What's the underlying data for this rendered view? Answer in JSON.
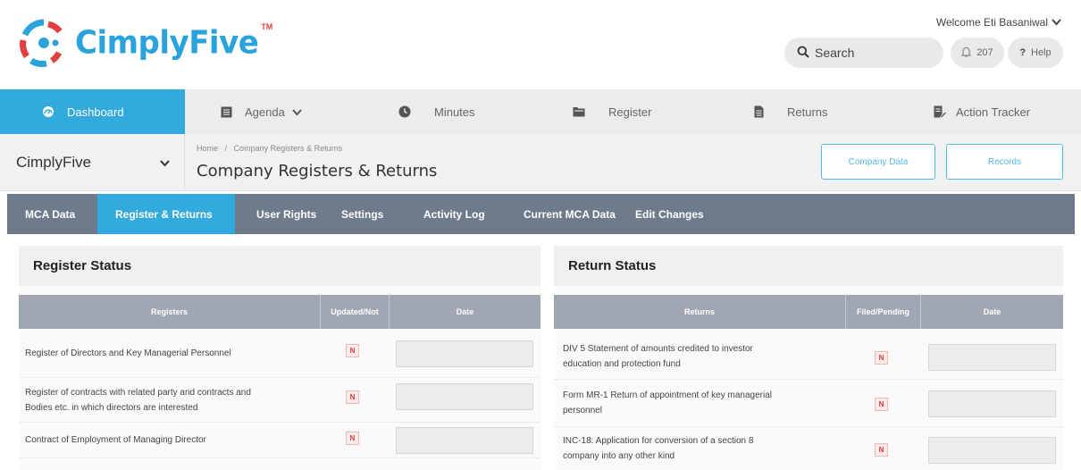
{
  "header": {
    "logo_text": "CimplyFive",
    "logo_tm": "TM",
    "welcome": "Welcome Eti Basaniwal",
    "search_placeholder": "Search",
    "notifications_count": "207",
    "help_label": "Help",
    "help_symbol": "?"
  },
  "colors": {
    "accent": "#33aade",
    "logo_blue": "#2aa3dc",
    "logo_red": "#e04040",
    "tab_bar": "#6d7b8c",
    "table_head": "#a0a7b2",
    "badge_red": "#e03a3a"
  },
  "nav": {
    "items": [
      {
        "label": "Dashboard",
        "icon": "dashboard-gauge-icon",
        "active": true
      },
      {
        "label": "Agenda",
        "icon": "list-icon"
      },
      {
        "label": "Minutes",
        "icon": "clock-icon"
      },
      {
        "label": "Register",
        "icon": "folder-icon"
      },
      {
        "label": "Returns",
        "icon": "document-icon"
      },
      {
        "label": "Action Tracker",
        "icon": "task-edit-icon"
      }
    ]
  },
  "subheader": {
    "company": "CimplyFive",
    "breadcrumb_home": "Home",
    "breadcrumb_sep": "/",
    "breadcrumb_current": "Company Registers & Returns",
    "title": "Company Registers & Returns",
    "company_data_btn": "Company Data",
    "records_btn": "Records"
  },
  "tabs": [
    "MCA Data",
    "Register & Returns",
    "User Rights",
    "Settings",
    "Activity Log",
    "Current MCA Data",
    "Edit Changes"
  ],
  "register_status": {
    "title": "Register Status",
    "columns": [
      "Registers",
      "Updated/Not",
      "Date"
    ],
    "rows": [
      {
        "line1": "Register of Directors and Key Managerial Personnel",
        "line2": "",
        "status": "N"
      },
      {
        "line1": "Register of contracts with related party and contracts and",
        "line2": "Bodies etc. in which directors are interested",
        "status": "N"
      },
      {
        "line1": "Contract of Employment of Managing Director",
        "line2": "",
        "status": "N"
      }
    ]
  },
  "return_status": {
    "title": "Return Status",
    "columns": [
      "Returns",
      "Filed/Pending",
      "Date"
    ],
    "rows": [
      {
        "line1": "DIV 5 Statement of amounts credited to investor",
        "line2": "education and protection fund",
        "status": "N"
      },
      {
        "line1": "Form MR-1 Return of appointment of key managerial",
        "line2": "personnel",
        "status": "N"
      },
      {
        "line1": "INC-18: Application for conversion of a section 8",
        "line2": "company into any other kind",
        "status": "N"
      }
    ]
  }
}
